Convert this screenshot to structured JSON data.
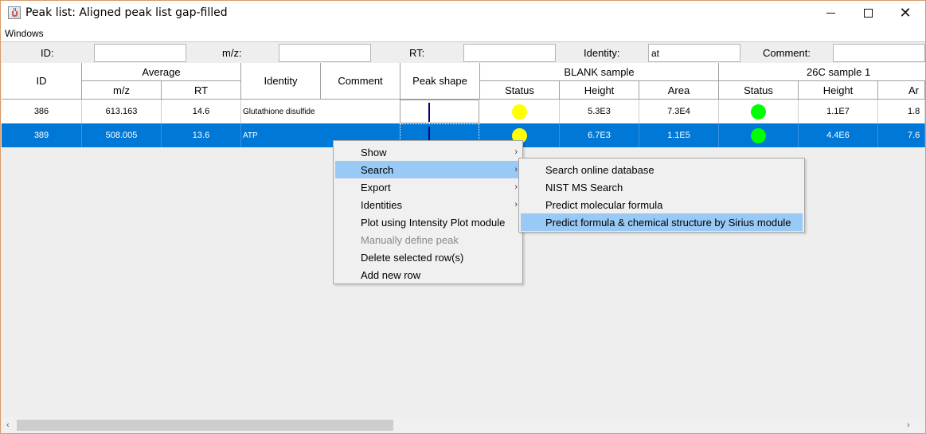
{
  "window": {
    "title": "Peak list: Aligned peak list gap-filled",
    "minimize_icon": "minimize-icon",
    "maximize_icon": "maximize-icon",
    "close_icon": "close-icon",
    "close_glyph": "✕"
  },
  "menubar": {
    "windows_label": "Windows"
  },
  "filters": {
    "id_label": "ID:",
    "id_value": "",
    "mz_label": "m/z:",
    "mz_value": "",
    "rt_label": "RT:",
    "rt_value": "",
    "identity_label": "Identity:",
    "identity_value": "at",
    "comment_label": "Comment:",
    "comment_value": ""
  },
  "table": {
    "headers": {
      "id": "ID",
      "average": "Average",
      "mz": "m/z",
      "rt": "RT",
      "identity": "Identity",
      "comment": "Comment",
      "peak_shape": "Peak shape",
      "blank_sample": "BLANK sample",
      "sample_26c": "26C sample 1",
      "status": "Status",
      "height": "Height",
      "area": "Area",
      "area_truncated": "Ar"
    },
    "rows": [
      {
        "id": "386",
        "mz": "613.163",
        "rt": "14.6",
        "identity": "Glutathione disulfide",
        "comment": "",
        "blank_status": "yellow",
        "blank_height": "5.3E3",
        "blank_area": "7.3E4",
        "s26c_status": "green",
        "s26c_height": "1.1E7",
        "s26c_area_truncated": "1.8"
      },
      {
        "id": "389",
        "mz": "508.005",
        "rt": "13.6",
        "identity": "ATP",
        "comment": "",
        "blank_status": "yellow",
        "blank_height": "6.7E3",
        "blank_area": "1.1E5",
        "s26c_status": "green",
        "s26c_height": "4.4E6",
        "s26c_area_truncated": "7.6"
      }
    ]
  },
  "context_menu": {
    "items": [
      {
        "label": "Show",
        "submenu": true
      },
      {
        "label": "Search",
        "submenu": true,
        "active": true
      },
      {
        "label": "Export",
        "submenu": true
      },
      {
        "label": "Identities",
        "submenu": true
      },
      {
        "label": "Plot using Intensity Plot module"
      },
      {
        "label": "Manually define peak",
        "disabled": true
      },
      {
        "label": "Delete selected row(s)"
      },
      {
        "label": "Add new row"
      }
    ],
    "arrow": "›"
  },
  "search_submenu": {
    "items": [
      {
        "label": "Search online database"
      },
      {
        "label": "NIST MS Search"
      },
      {
        "label": "Predict molecular formula"
      },
      {
        "label": "Predict formula & chemical structure by Sirius module",
        "active": true
      }
    ]
  },
  "scrollbar": {
    "left_arrow": "‹",
    "right_arrow": "›"
  },
  "colors": {
    "selection": "#0078d7",
    "menu_highlight": "#99c9f5",
    "status_yellow": "#ffff00",
    "status_green": "#00ff00"
  }
}
